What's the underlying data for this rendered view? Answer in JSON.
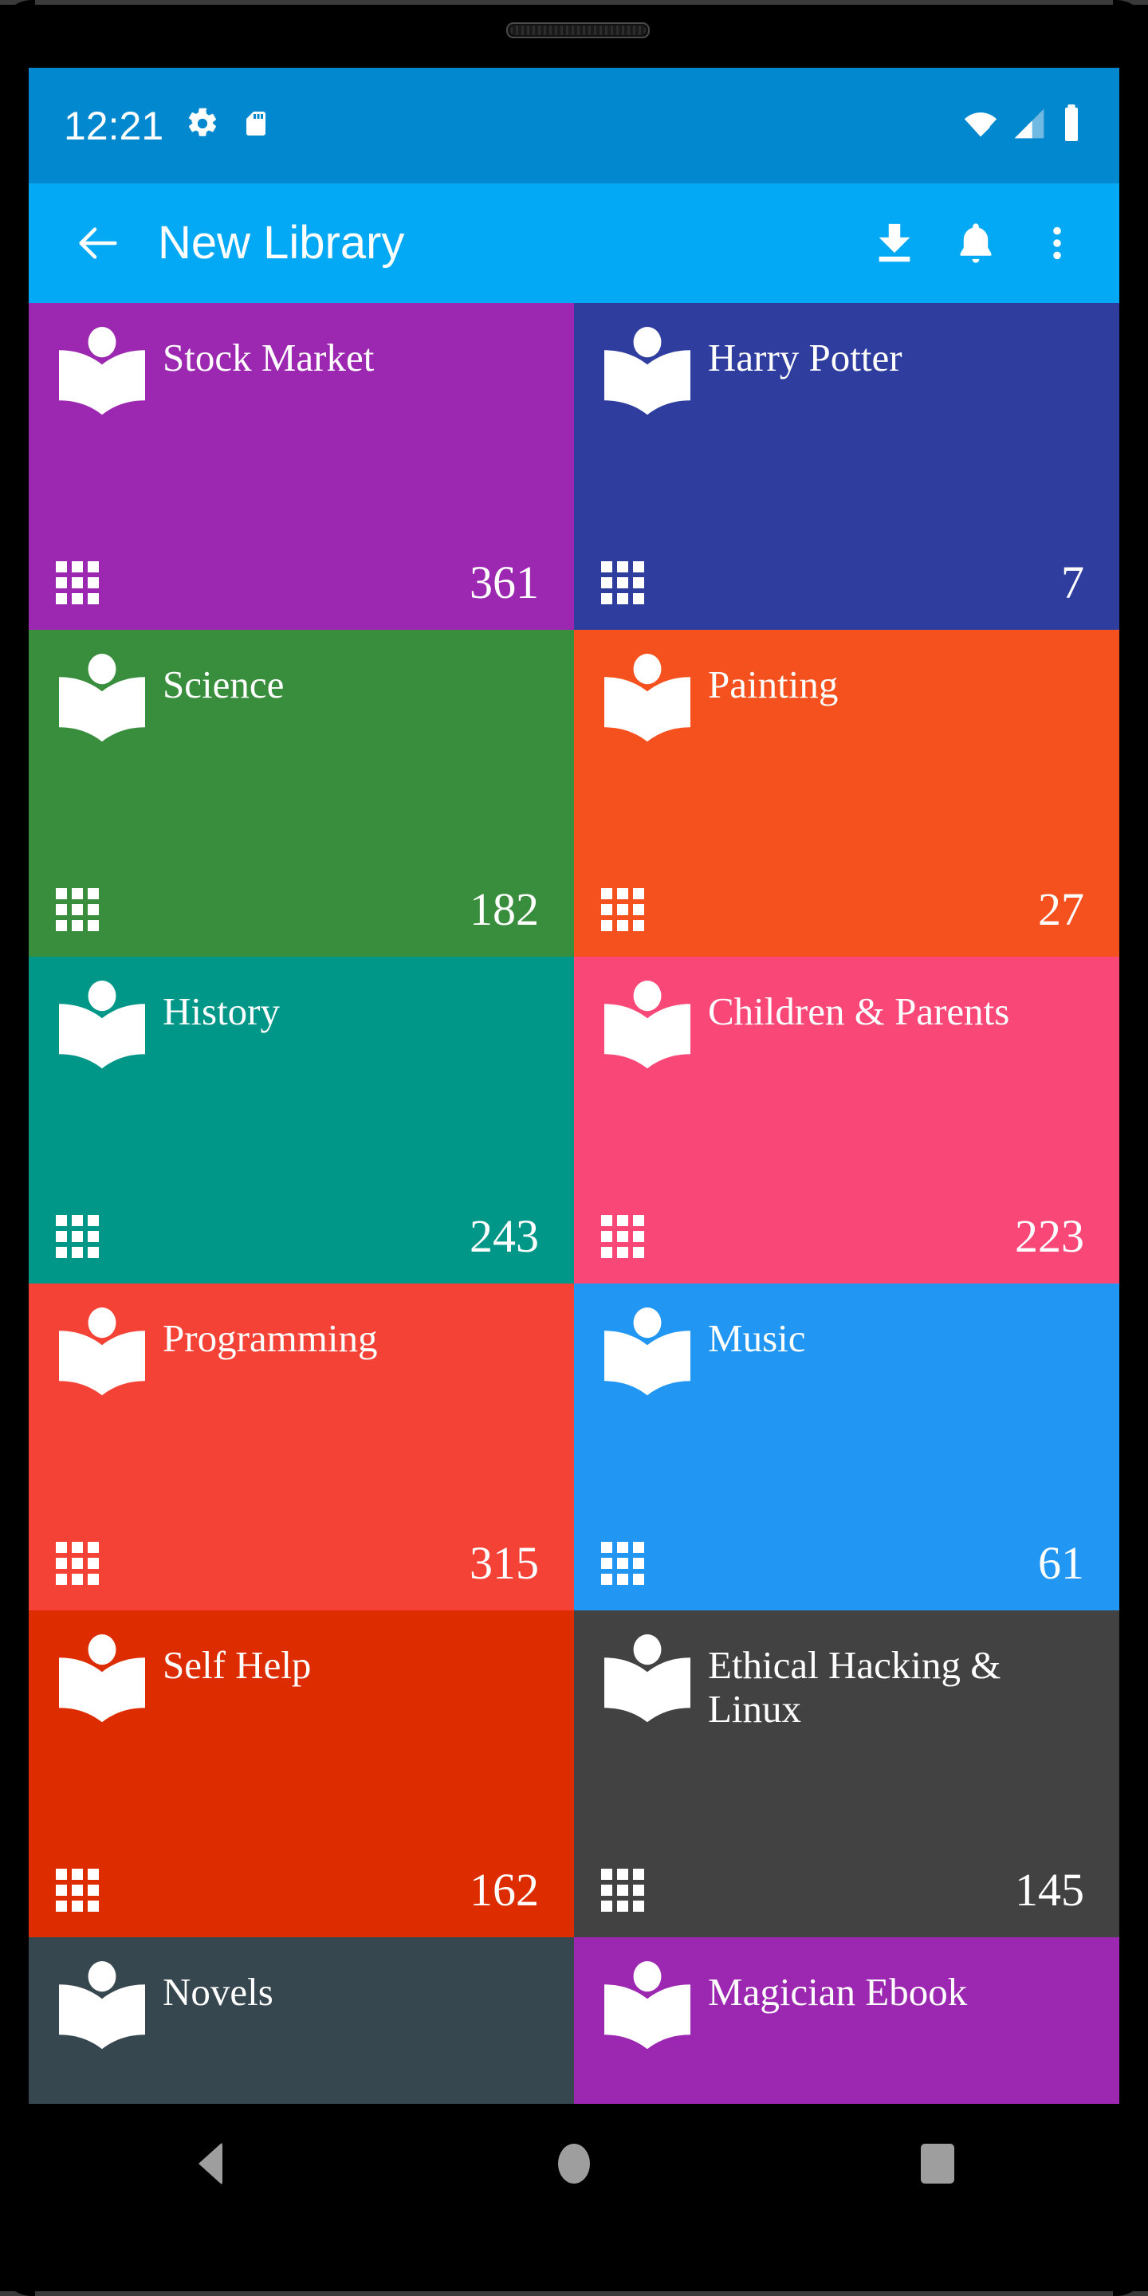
{
  "status_bar": {
    "time": "12:21",
    "icons": [
      "gear-icon",
      "sd-card-icon"
    ],
    "right_icons": [
      "wifi-icon",
      "cellular-signal-icon",
      "battery-icon"
    ],
    "background": "#0288ce"
  },
  "app_bar": {
    "back_label": "back-arrow-icon",
    "title": "New Library",
    "background": "#03a9f4",
    "actions": [
      {
        "name": "download-icon",
        "label": "Download"
      },
      {
        "name": "bell-icon",
        "label": "Notifications"
      },
      {
        "name": "overflow-menu-icon",
        "label": "More options"
      }
    ]
  },
  "library": {
    "tiles": [
      {
        "title": "Stock Market",
        "count": "361",
        "color": "#9c27b0"
      },
      {
        "title": "Harry Potter",
        "count": "7",
        "color": "#2f3e9e"
      },
      {
        "title": "Science",
        "count": "182",
        "color": "#388e3c"
      },
      {
        "title": "Painting",
        "count": "27",
        "color": "#f4511e"
      },
      {
        "title": "History",
        "count": "243",
        "color": "#009688"
      },
      {
        "title": "Children & Parents",
        "count": "223",
        "color": "#f94877"
      },
      {
        "title": "Programming",
        "count": "315",
        "color": "#f44336"
      },
      {
        "title": "Music",
        "count": "61",
        "color": "#2196f3"
      },
      {
        "title": "Self Help",
        "count": "162",
        "color": "#dd2c00"
      },
      {
        "title": "Ethical Hacking & Linux",
        "count": "145",
        "color": "#424242"
      },
      {
        "title": "Novels",
        "count": "",
        "color": "#37474f"
      },
      {
        "title": "Magician Ebook",
        "count": "",
        "color": "#9c27b0"
      }
    ]
  },
  "nav_bar": {
    "buttons": [
      {
        "name": "nav-back-button",
        "label": "Back"
      },
      {
        "name": "nav-home-button",
        "label": "Home"
      },
      {
        "name": "nav-recents-button",
        "label": "Recents"
      }
    ]
  }
}
